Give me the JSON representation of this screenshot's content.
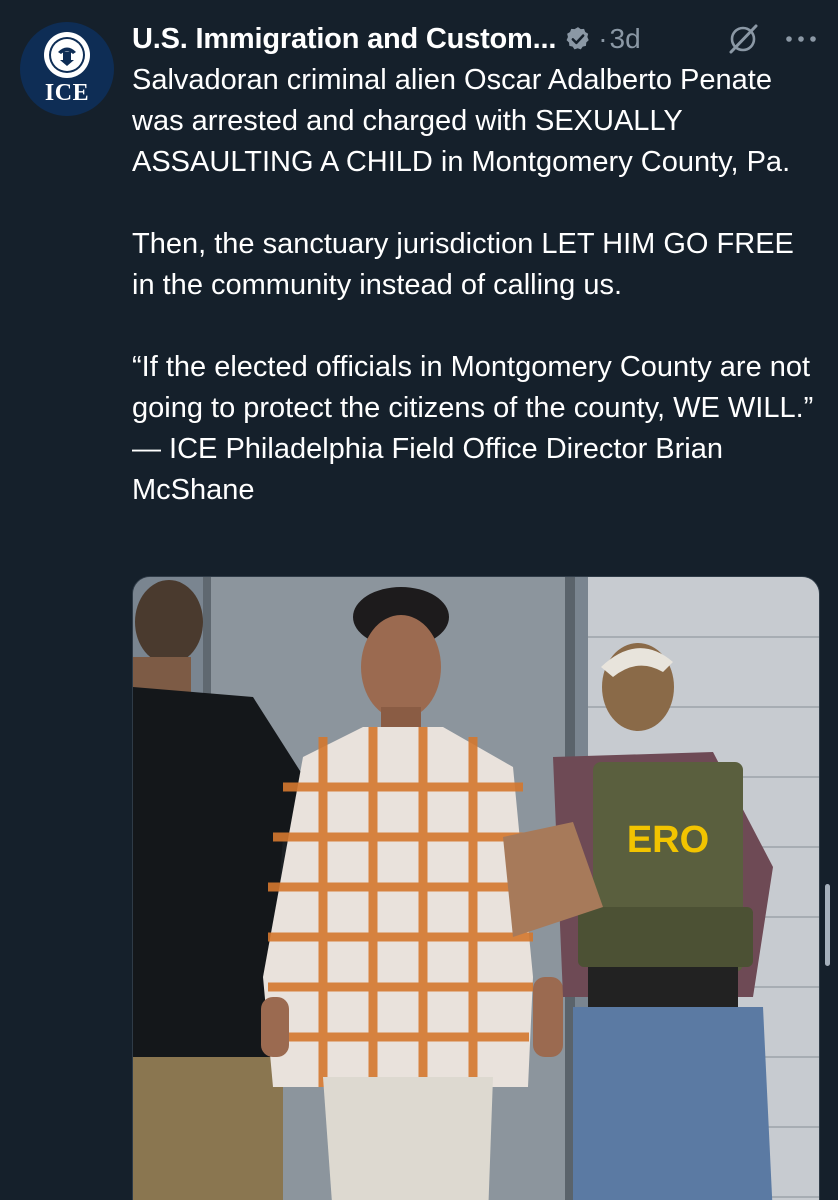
{
  "account": {
    "display_name": "U.S. Immigration and Custom...",
    "avatar_text": "ICE",
    "verified_icon": "verified-badge-icon",
    "verified_color": "#8b98a5"
  },
  "tweet": {
    "separator": "·",
    "timestamp": "3d",
    "paragraphs": [
      "Salvadoran criminal alien Oscar Adalberto Penate was arrested and charged with SEXUALLY ASSAULTING A CHILD in Montgomery County, Pa.",
      "Then, the sanctuary jurisdiction LET HIM GO FREE in the community instead of calling us.",
      "“If the elected officials in Montgomery County are not going to protect the citizens of the county, WE WILL.” — ICE Philadelphia Field Office Director Brian McShane"
    ]
  },
  "photo": {
    "vest_text": "ERO"
  },
  "icons": {
    "grok": "grok-icon",
    "more": "more-options-icon"
  },
  "colors": {
    "background": "#15202b",
    "text": "#ffffff",
    "muted": "#8b98a5",
    "avatar": "#0e2d55",
    "vest_text": "#f2c400"
  }
}
